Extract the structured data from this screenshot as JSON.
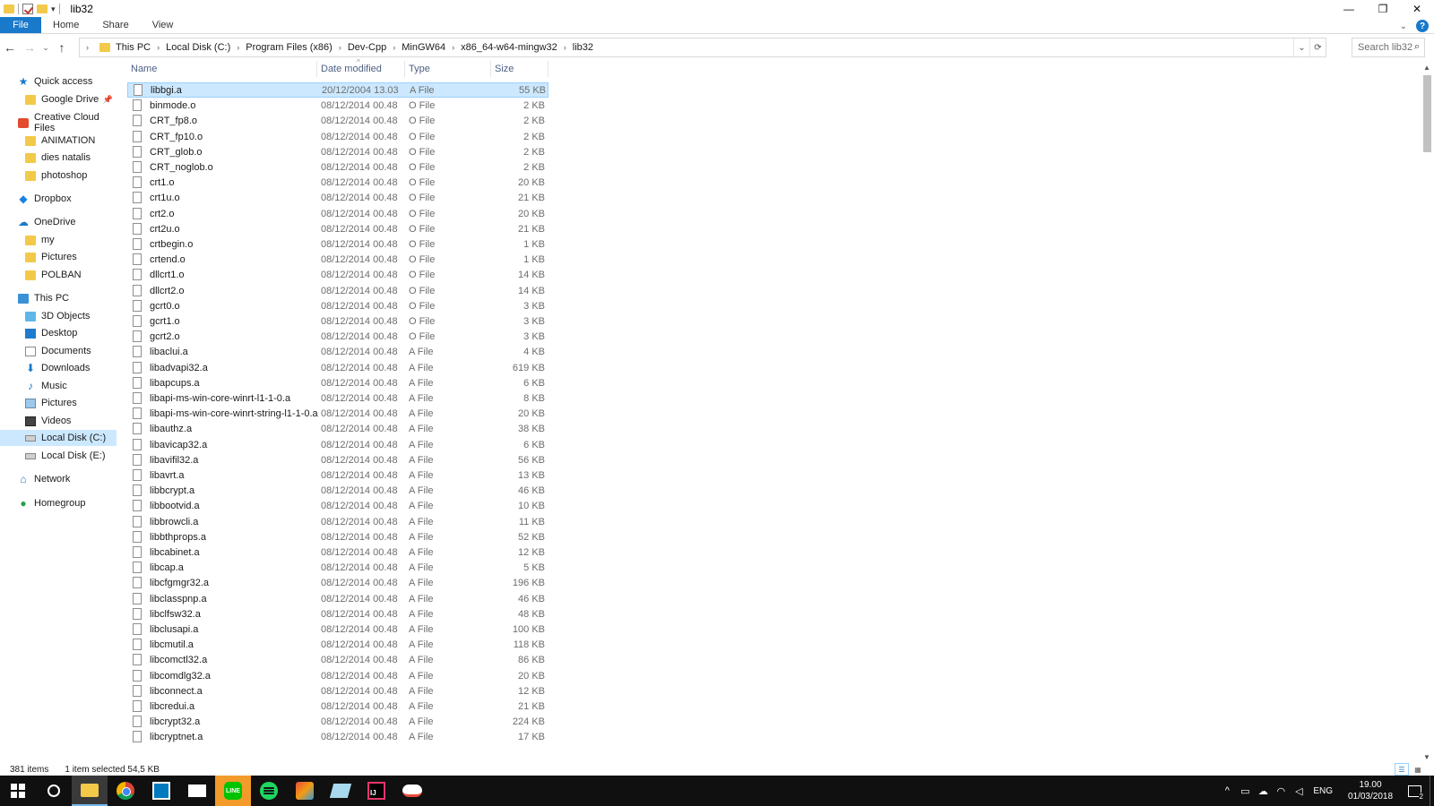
{
  "window": {
    "title": "lib32",
    "qat_arrow": "▾",
    "controls": {
      "minimize": "—",
      "restore": "❐",
      "close": "✕"
    }
  },
  "ribbon": {
    "tabs": [
      "File",
      "Home",
      "Share",
      "View"
    ],
    "collapse_icon": "⌄",
    "help_icon": "?"
  },
  "nav": {
    "back": "←",
    "forward": "→",
    "recent": "⌄",
    "up": "↑"
  },
  "address": {
    "crumbs": [
      "This PC",
      "Local Disk (C:)",
      "Program Files (x86)",
      "Dev-Cpp",
      "MinGW64",
      "x86_64-w64-mingw32",
      "lib32"
    ],
    "lead_arrow": "›",
    "dropdown_icon": "⌄",
    "refresh_icon": "⟳"
  },
  "search": {
    "placeholder": "Search lib32",
    "icon": "⌕"
  },
  "sidebar": {
    "items": [
      {
        "label": "Quick access",
        "icon": "star-icon",
        "pin": false
      },
      {
        "label": "Google Drive",
        "icon": "folder-icon",
        "pin": true
      },
      {
        "label": "Creative Cloud Files",
        "icon": "creative-cloud-icon",
        "pin": false
      },
      {
        "label": "ANIMATION",
        "icon": "folder-icon",
        "pin": false
      },
      {
        "label": "dies natalis",
        "icon": "folder-icon",
        "pin": false
      },
      {
        "label": "photoshop",
        "icon": "folder-icon",
        "pin": false
      },
      {
        "label": "Dropbox",
        "icon": "dropbox-icon",
        "pin": false
      },
      {
        "label": "OneDrive",
        "icon": "onedrive-icon",
        "pin": false
      },
      {
        "label": "my",
        "icon": "folder-icon",
        "pin": false
      },
      {
        "label": "Pictures",
        "icon": "folder-icon",
        "pin": false
      },
      {
        "label": "POLBAN",
        "icon": "folder-icon",
        "pin": false
      },
      {
        "label": "This PC",
        "icon": "pc-icon",
        "pin": false
      },
      {
        "label": "3D Objects",
        "icon": "3d-objects-icon",
        "pin": false
      },
      {
        "label": "Desktop",
        "icon": "desktop-icon",
        "pin": false
      },
      {
        "label": "Documents",
        "icon": "documents-icon",
        "pin": false
      },
      {
        "label": "Downloads",
        "icon": "downloads-icon",
        "pin": false
      },
      {
        "label": "Music",
        "icon": "music-icon",
        "pin": false
      },
      {
        "label": "Pictures",
        "icon": "pictures-icon",
        "pin": false
      },
      {
        "label": "Videos",
        "icon": "videos-icon",
        "pin": false
      },
      {
        "label": "Local Disk (C:)",
        "icon": "drive-icon",
        "pin": false,
        "selected": true
      },
      {
        "label": "Local Disk (E:)",
        "icon": "drive-icon",
        "pin": false
      },
      {
        "label": "Network",
        "icon": "network-icon",
        "pin": false
      },
      {
        "label": "Homegroup",
        "icon": "homegroup-icon",
        "pin": false
      }
    ]
  },
  "columns": {
    "name": "Name",
    "date": "Date modified",
    "type": "Type",
    "size": "Size",
    "sort_caret": "^"
  },
  "files": [
    {
      "name": "libbgi.a",
      "date": "20/12/2004 13.03",
      "type": "A File",
      "size": "55 KB",
      "selected": true
    },
    {
      "name": "binmode.o",
      "date": "08/12/2014 00.48",
      "type": "O File",
      "size": "2 KB"
    },
    {
      "name": "CRT_fp8.o",
      "date": "08/12/2014 00.48",
      "type": "O File",
      "size": "2 KB"
    },
    {
      "name": "CRT_fp10.o",
      "date": "08/12/2014 00.48",
      "type": "O File",
      "size": "2 KB"
    },
    {
      "name": "CRT_glob.o",
      "date": "08/12/2014 00.48",
      "type": "O File",
      "size": "2 KB"
    },
    {
      "name": "CRT_noglob.o",
      "date": "08/12/2014 00.48",
      "type": "O File",
      "size": "2 KB"
    },
    {
      "name": "crt1.o",
      "date": "08/12/2014 00.48",
      "type": "O File",
      "size": "20 KB"
    },
    {
      "name": "crt1u.o",
      "date": "08/12/2014 00.48",
      "type": "O File",
      "size": "21 KB"
    },
    {
      "name": "crt2.o",
      "date": "08/12/2014 00.48",
      "type": "O File",
      "size": "20 KB"
    },
    {
      "name": "crt2u.o",
      "date": "08/12/2014 00.48",
      "type": "O File",
      "size": "21 KB"
    },
    {
      "name": "crtbegin.o",
      "date": "08/12/2014 00.48",
      "type": "O File",
      "size": "1 KB"
    },
    {
      "name": "crtend.o",
      "date": "08/12/2014 00.48",
      "type": "O File",
      "size": "1 KB"
    },
    {
      "name": "dllcrt1.o",
      "date": "08/12/2014 00.48",
      "type": "O File",
      "size": "14 KB"
    },
    {
      "name": "dllcrt2.o",
      "date": "08/12/2014 00.48",
      "type": "O File",
      "size": "14 KB"
    },
    {
      "name": "gcrt0.o",
      "date": "08/12/2014 00.48",
      "type": "O File",
      "size": "3 KB"
    },
    {
      "name": "gcrt1.o",
      "date": "08/12/2014 00.48",
      "type": "O File",
      "size": "3 KB"
    },
    {
      "name": "gcrt2.o",
      "date": "08/12/2014 00.48",
      "type": "O File",
      "size": "3 KB"
    },
    {
      "name": "libaclui.a",
      "date": "08/12/2014 00.48",
      "type": "A File",
      "size": "4 KB"
    },
    {
      "name": "libadvapi32.a",
      "date": "08/12/2014 00.48",
      "type": "A File",
      "size": "619 KB"
    },
    {
      "name": "libapcups.a",
      "date": "08/12/2014 00.48",
      "type": "A File",
      "size": "6 KB"
    },
    {
      "name": "libapi-ms-win-core-winrt-l1-1-0.a",
      "date": "08/12/2014 00.48",
      "type": "A File",
      "size": "8 KB"
    },
    {
      "name": "libapi-ms-win-core-winrt-string-l1-1-0.a",
      "date": "08/12/2014 00.48",
      "type": "A File",
      "size": "20 KB"
    },
    {
      "name": "libauthz.a",
      "date": "08/12/2014 00.48",
      "type": "A File",
      "size": "38 KB"
    },
    {
      "name": "libavicap32.a",
      "date": "08/12/2014 00.48",
      "type": "A File",
      "size": "6 KB"
    },
    {
      "name": "libavifil32.a",
      "date": "08/12/2014 00.48",
      "type": "A File",
      "size": "56 KB"
    },
    {
      "name": "libavrt.a",
      "date": "08/12/2014 00.48",
      "type": "A File",
      "size": "13 KB"
    },
    {
      "name": "libbcrypt.a",
      "date": "08/12/2014 00.48",
      "type": "A File",
      "size": "46 KB"
    },
    {
      "name": "libbootvid.a",
      "date": "08/12/2014 00.48",
      "type": "A File",
      "size": "10 KB"
    },
    {
      "name": "libbrowcli.a",
      "date": "08/12/2014 00.48",
      "type": "A File",
      "size": "11 KB"
    },
    {
      "name": "libbthprops.a",
      "date": "08/12/2014 00.48",
      "type": "A File",
      "size": "52 KB"
    },
    {
      "name": "libcabinet.a",
      "date": "08/12/2014 00.48",
      "type": "A File",
      "size": "12 KB"
    },
    {
      "name": "libcap.a",
      "date": "08/12/2014 00.48",
      "type": "A File",
      "size": "5 KB"
    },
    {
      "name": "libcfgmgr32.a",
      "date": "08/12/2014 00.48",
      "type": "A File",
      "size": "196 KB"
    },
    {
      "name": "libclasspnp.a",
      "date": "08/12/2014 00.48",
      "type": "A File",
      "size": "46 KB"
    },
    {
      "name": "libclfsw32.a",
      "date": "08/12/2014 00.48",
      "type": "A File",
      "size": "48 KB"
    },
    {
      "name": "libclusapi.a",
      "date": "08/12/2014 00.48",
      "type": "A File",
      "size": "100 KB"
    },
    {
      "name": "libcmutil.a",
      "date": "08/12/2014 00.48",
      "type": "A File",
      "size": "118 KB"
    },
    {
      "name": "libcomctl32.a",
      "date": "08/12/2014 00.48",
      "type": "A File",
      "size": "86 KB"
    },
    {
      "name": "libcomdlg32.a",
      "date": "08/12/2014 00.48",
      "type": "A File",
      "size": "20 KB"
    },
    {
      "name": "libconnect.a",
      "date": "08/12/2014 00.48",
      "type": "A File",
      "size": "12 KB"
    },
    {
      "name": "libcredui.a",
      "date": "08/12/2014 00.48",
      "type": "A File",
      "size": "21 KB"
    },
    {
      "name": "libcrypt32.a",
      "date": "08/12/2014 00.48",
      "type": "A File",
      "size": "224 KB"
    },
    {
      "name": "libcryptnet.a",
      "date": "08/12/2014 00.48",
      "type": "A File",
      "size": "17 KB"
    }
  ],
  "status": {
    "items": "381 items",
    "selection": "1 item selected  54,5 KB"
  },
  "scrollbar": {
    "up": "▲",
    "down": "▼"
  },
  "taskbar": {
    "apps": [
      "start-icon",
      "cortana-icon",
      "file-explorer-icon",
      "chrome-icon",
      "trello-icon",
      "mail-icon",
      "line-icon",
      "spotify-icon",
      "paint-icon",
      "notes-icon",
      "intellij-icon",
      "cloud-app-icon"
    ],
    "line_label": "LINE",
    "ij_label": "IJ",
    "tray": {
      "chevron": "^",
      "battery": "▭",
      "cloud": "☁",
      "wifi": "◠",
      "volume": "◁",
      "lang": "ENG",
      "time": "19.00",
      "date": "01/03/2018",
      "notif_count": "2"
    }
  },
  "colors": {
    "accent": "#1979ca",
    "selection": "#cce8ff",
    "taskbar": "#101010"
  }
}
